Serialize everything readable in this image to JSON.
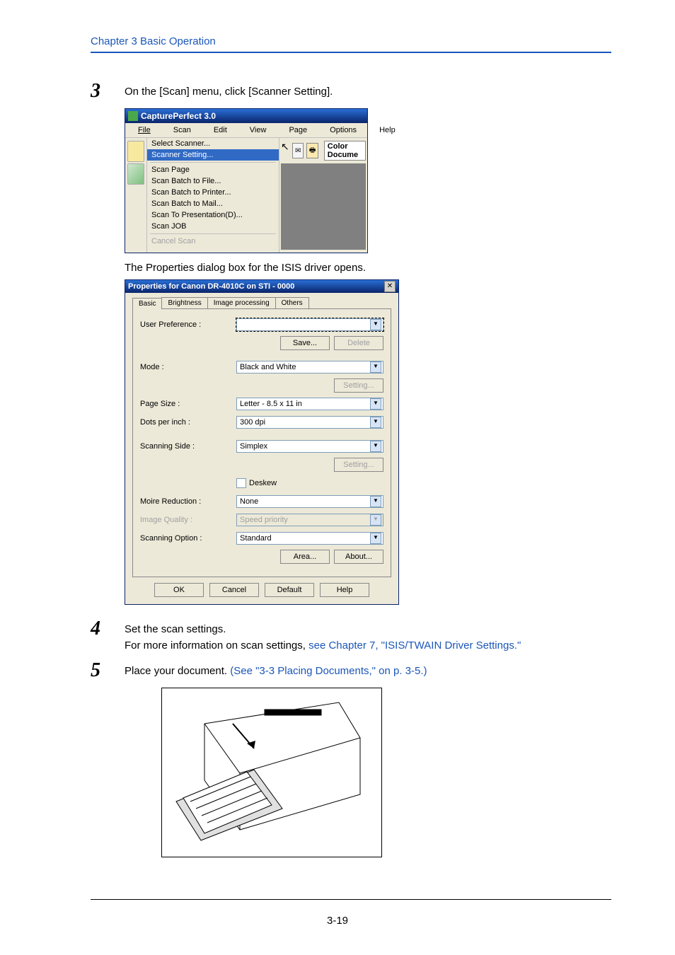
{
  "header": {
    "chapter": "Chapter 3   Basic Operation"
  },
  "steps": {
    "s3": {
      "num": "3",
      "text": "On the [Scan] menu, click [Scanner Setting]."
    },
    "s4": {
      "num": "4",
      "text1": "Set the scan settings.",
      "text2a": "For more information on scan settings, ",
      "text2b": "see Chapter 7, \"ISIS/TWAIN Driver Settings.\""
    },
    "s5": {
      "num": "5",
      "text1a": "Place your document. ",
      "text1b": "(See \"3-3 Placing Documents,\" on p. 3-5.)"
    }
  },
  "between_text": "The Properties dialog box for the ISIS driver opens.",
  "cp": {
    "title": "CapturePerfect 3.0",
    "menu": {
      "file": "File",
      "scan": "Scan",
      "edit": "Edit",
      "view": "View",
      "page": "Page",
      "options": "Options",
      "help": "Help"
    },
    "dropdown": {
      "select_scanner": "Select Scanner...",
      "scanner_setting": "Scanner Setting...",
      "scan_page": "Scan Page",
      "scan_batch_file": "Scan Batch to File...",
      "scan_batch_printer": "Scan Batch to Printer...",
      "scan_batch_mail": "Scan Batch to Mail...",
      "scan_to_presentation": "Scan To Presentation(D)...",
      "scan_job": "Scan JOB",
      "cancel_scan": "Cancel Scan"
    },
    "right": {
      "color_docs": "Color Docume"
    }
  },
  "props": {
    "title": "Properties for Canon DR-4010C on STI - 0000",
    "tabs": {
      "basic": "Basic",
      "brightness": "Brightness",
      "image_processing": "Image processing",
      "others": "Others"
    },
    "labels": {
      "user_pref": "User Preference :",
      "mode": "Mode :",
      "page_size": "Page Size :",
      "dpi": "Dots per inch :",
      "scanning_side": "Scanning Side :",
      "deskew": "Deskew",
      "moire": "Moire Reduction :",
      "image_quality": "Image Quality :",
      "scanning_option": "Scanning Option :"
    },
    "values": {
      "user_pref": "",
      "mode": "Black and White",
      "page_size": "Letter - 8.5 x 11 in",
      "dpi": "300 dpi",
      "scanning_side": "Simplex",
      "moire": "None",
      "image_quality": "Speed priority",
      "scanning_option": "Standard"
    },
    "buttons": {
      "save": "Save...",
      "delete": "Delete",
      "setting1": "Setting...",
      "setting2": "Setting...",
      "area": "Area...",
      "about": "About...",
      "ok": "OK",
      "cancel": "Cancel",
      "default": "Default",
      "help": "Help"
    }
  },
  "footer": {
    "page": "3-19"
  }
}
